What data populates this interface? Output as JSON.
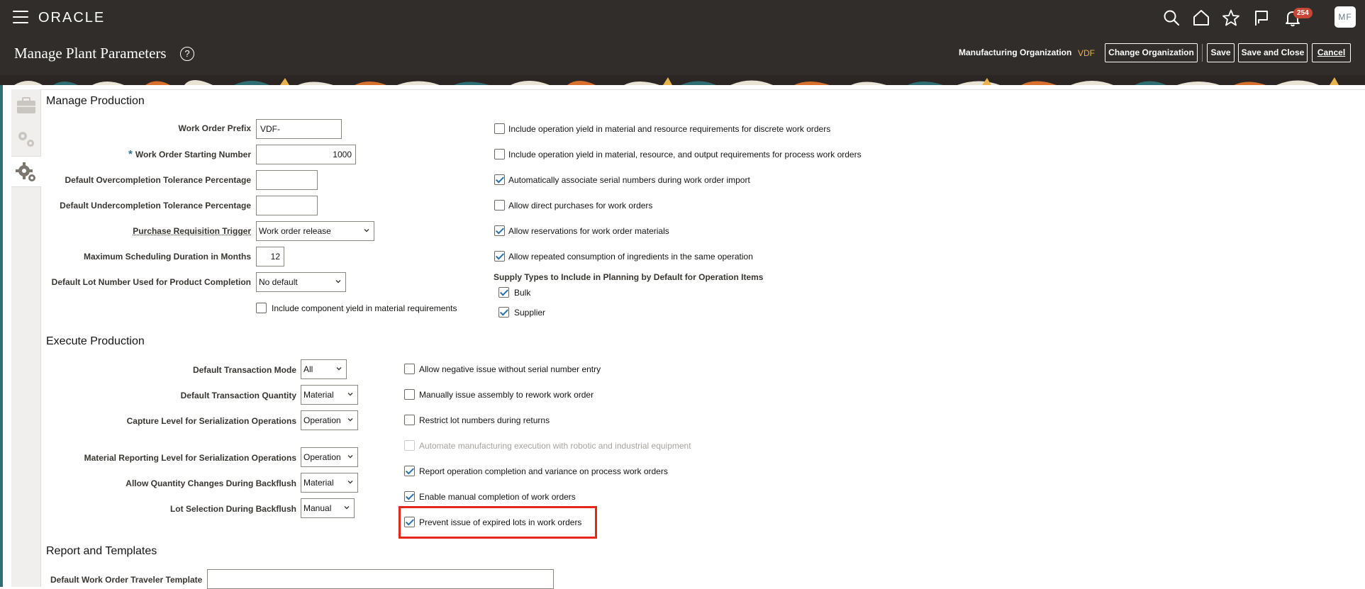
{
  "brand": "ORACLE",
  "notifications": {
    "count": "254"
  },
  "user": {
    "initials": "MF"
  },
  "header": {
    "title": "Manage Plant Parameters",
    "help": "?",
    "org_label": "Manufacturing Organization",
    "org_value": "VDF",
    "buttons": {
      "change_org": "Change Organization",
      "save": "Save",
      "save_close": "Save and Close",
      "cancel": "Cancel"
    }
  },
  "manage_production": {
    "title": "Manage Production",
    "work_order_prefix": {
      "label": "Work Order Prefix",
      "value": "VDF-"
    },
    "work_order_starting_number": {
      "required": "*",
      "label": "Work Order Starting Number",
      "value": "1000"
    },
    "overcompletion": {
      "label": "Default Overcompletion Tolerance Percentage",
      "value": ""
    },
    "undercompletion": {
      "label": "Default Undercompletion Tolerance Percentage",
      "value": ""
    },
    "purchase_requisition_trigger": {
      "label": "Purchase Requisition Trigger",
      "value": "Work order release"
    },
    "max_scheduling_duration": {
      "label": "Maximum Scheduling Duration in Months",
      "value": "12"
    },
    "default_lot_number": {
      "label": "Default Lot Number Used for Product Completion",
      "value": "No default"
    },
    "include_component_yield": {
      "label": "Include component yield in material requirements",
      "checked": false
    },
    "checkboxes": [
      {
        "label": "Include operation yield in material and resource requirements for discrete work orders",
        "checked": false
      },
      {
        "label": "Include operation yield in material, resource, and output requirements for process work orders",
        "checked": false
      },
      {
        "label": "Automatically associate serial numbers during work order import",
        "checked": true
      },
      {
        "label": "Allow direct purchases for work orders",
        "checked": false
      },
      {
        "label": "Allow reservations for work order materials",
        "checked": true
      },
      {
        "label": "Allow repeated consumption of ingredients in the same operation",
        "checked": true
      }
    ],
    "supply_types": {
      "label": "Supply Types to Include in Planning by Default for Operation Items",
      "items": [
        {
          "label": "Bulk",
          "checked": true
        },
        {
          "label": "Supplier",
          "checked": true
        }
      ]
    }
  },
  "execute_production": {
    "title": "Execute Production",
    "fields": [
      {
        "label": "Default Transaction Mode",
        "value": "All"
      },
      {
        "label": "Default Transaction Quantity",
        "value": "Material"
      },
      {
        "label": "Capture Level for Serialization Operations",
        "value": "Operation"
      },
      {
        "label": "Material Reporting Level for Serialization Operations",
        "value": "Operation"
      },
      {
        "label": "Allow Quantity Changes During Backflush",
        "value": "Material"
      },
      {
        "label": "Lot Selection During Backflush",
        "value": "Manual"
      }
    ],
    "checkboxes": [
      {
        "label": "Allow negative issue without serial number entry",
        "checked": false
      },
      {
        "label": "Manually issue assembly to rework work order",
        "checked": false
      },
      {
        "label": "Restrict lot numbers during returns",
        "checked": false
      },
      {
        "label": "Automate manufacturing execution with robotic and industrial equipment",
        "checked": false,
        "disabled": true
      },
      {
        "label": "Report operation completion and variance on process work orders",
        "checked": true
      },
      {
        "label": "Enable manual completion of work orders",
        "checked": true
      },
      {
        "label": "Prevent issue of expired lots in work orders",
        "checked": true
      }
    ]
  },
  "report_templates": {
    "title": "Report and Templates",
    "traveler_template": {
      "label": "Default Work Order Traveler Template",
      "value": ""
    }
  },
  "colors": {
    "topbar": "#312d2a",
    "accent_gold": "#e7b34e",
    "check_blue": "#2a6fa8",
    "highlight_red": "#e5261b",
    "badge_red": "#c74634"
  },
  "icons": [
    "menu-icon",
    "search-icon",
    "home-icon",
    "star-icon",
    "flag-icon",
    "bell-icon",
    "help-icon",
    "chevron-down-icon",
    "briefcase-icon",
    "gears-icon",
    "settings-gear-icon"
  ]
}
